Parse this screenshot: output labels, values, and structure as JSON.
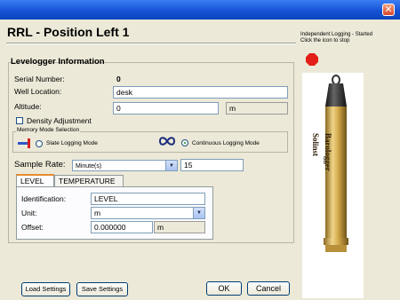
{
  "window": {
    "title": "RRL - Position Left 1",
    "close_glyph": "✕",
    "close_icon": "close-icon"
  },
  "info": {
    "group_title": "Levelogger Information",
    "serial_label": "Serial Number:",
    "serial_value": "0",
    "well_label": "Well Location:",
    "well_value": "desk",
    "altitude_label": "Altitude:",
    "altitude_value": "0",
    "altitude_unit": "m",
    "density_label": "Density Adjustment"
  },
  "memory": {
    "title": "Memory Mode Selection",
    "slate_label": "Slate Logging Mode",
    "continuous_label": "Continuous Logging Mode",
    "selected": "continuous"
  },
  "sample": {
    "label": "Sample Rate:",
    "unit_value": "Minute(s)",
    "rate_value": "15"
  },
  "tabs": [
    {
      "label": "LEVEL",
      "active": true
    },
    {
      "label": "TEMPERATURE",
      "active": false
    }
  ],
  "level": {
    "identification_label": "Identification:",
    "identification_value": "LEVEL",
    "unit_label": "Unit:",
    "unit_value": "m",
    "offset_label": "Offset:",
    "offset_value": "0.000000",
    "offset_unit": "m"
  },
  "buttons": {
    "load": "Load Settings",
    "save": "Save Settings",
    "ok": "OK",
    "cancel": "Cancel"
  },
  "status": {
    "line1": "Independent Logging - Started",
    "line2": "Click the icon to stop",
    "stop_icon": "stop-icon"
  },
  "device": {
    "label1": "Solinst",
    "label2": "Barologger"
  },
  "colors": {
    "titlebar": "#1553d4",
    "stop": "#e22018",
    "tab_accent": "#e68b2c",
    "logger_body": "#d4a94a"
  }
}
